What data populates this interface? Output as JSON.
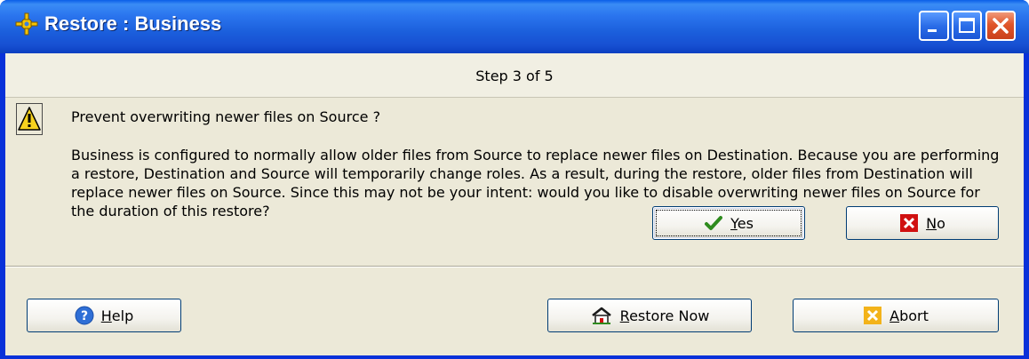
{
  "window": {
    "title": "Restore : Business"
  },
  "step": {
    "label": "Step 3 of 5"
  },
  "prompt": {
    "question": "Prevent overwriting newer files on Source ?",
    "message": "Business is configured to normally allow older files from Source to replace newer files on Destination. Because you are performing a restore, Destination and Source will temporarily change roles. As a result, during the restore, older files from Destination will replace newer files on Source. Since this may not be your intent: would you like to disable overwriting newer files on Source for the duration of this restore?"
  },
  "buttons": {
    "yes": {
      "accel": "Y",
      "rest": "es"
    },
    "no": {
      "accel": "N",
      "rest": "o"
    },
    "help": {
      "accel": "H",
      "rest": "elp"
    },
    "restore_now": {
      "accel": "R",
      "rest": "estore Now"
    },
    "abort": {
      "accel": "A",
      "rest": "bort"
    }
  },
  "icons": {
    "app": "app-gear-icon",
    "warning": "warning-icon",
    "yes": "checkmark-icon",
    "no": "red-x-icon",
    "help": "help-icon",
    "restore": "restore-house-icon",
    "abort": "abort-icon"
  },
  "colors": {
    "titlebar": "#1b5fdc",
    "client_bg": "#ece9d8",
    "close_button": "#e0552a",
    "yes_check": "#2e8b1e",
    "no_x": "#d01010",
    "abort_icon": "#f3b31a"
  }
}
